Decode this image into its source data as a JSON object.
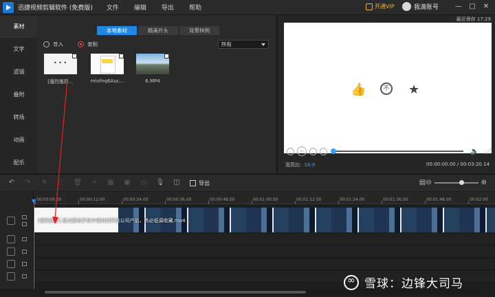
{
  "titlebar": {
    "app_title": "迅捷视频剪辑软件 (免费版)",
    "menu": [
      "文件",
      "编辑",
      "导出",
      "帮助"
    ],
    "vip_label": "开通VIP",
    "account_label": "我滴账号",
    "window_buttons": [
      "—",
      "□",
      "✕"
    ]
  },
  "leftnav": {
    "items": [
      {
        "label": "素材",
        "active": true
      },
      {
        "label": "文字",
        "active": false
      },
      {
        "label": "滤镜",
        "active": false
      },
      {
        "label": "叠附",
        "active": false
      },
      {
        "label": "转场",
        "active": false
      },
      {
        "label": "动画",
        "active": false
      },
      {
        "label": "配乐",
        "active": false
      }
    ]
  },
  "media": {
    "tabs": [
      {
        "label": "本地素材",
        "active": true
      },
      {
        "label": "精美片头",
        "active": false
      },
      {
        "label": "背景样例",
        "active": false
      }
    ],
    "import_label": "导入",
    "record_label": "录制",
    "filter_value": "所有",
    "items": [
      {
        "caption": "[强烈推荐..."
      },
      {
        "caption": "mlofnq6Auc..."
      },
      {
        "caption": "6.MP4"
      }
    ]
  },
  "preview": {
    "saved_text": "最近保存 17:29",
    "aspect_label": "宽高比:",
    "aspect_value": "16:9",
    "timecode": "00:00:00.00 / 00:03:20.14",
    "progress_fraction": 0.0
  },
  "toolbar": {
    "export_label": "导出",
    "zoom_fraction": 0.55
  },
  "timeline": {
    "ruler_ticks": [
      "00:00:00.00",
      "00:00:12.00",
      "00:00:24.00",
      "00:00:36.00",
      "00:00:48.00",
      "00:01:00.00",
      "00:01:12.00",
      "00:01:24.00",
      "00:01:36.00",
      "00:01:48.00",
      "00:02:00"
    ],
    "clip_label": "[强烈推荐] 盘点那些手机中便利的科技公司产品，务必低调收藏.mp4"
  },
  "watermark": {
    "text": "雪球：边锋大司马"
  }
}
